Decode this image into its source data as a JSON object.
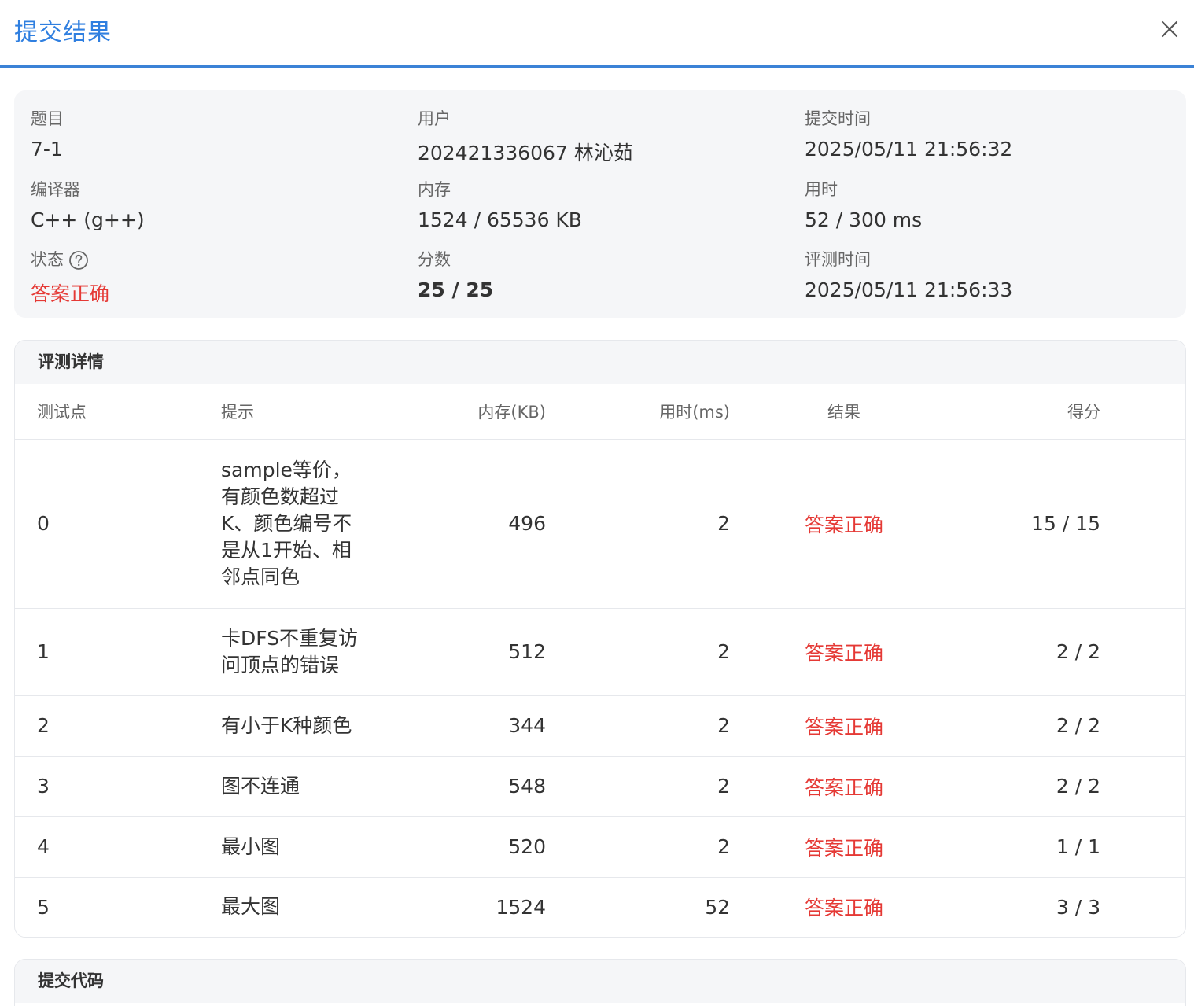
{
  "dialog": {
    "title": "提交结果"
  },
  "info": {
    "problem": {
      "label": "题目",
      "value": "7-1"
    },
    "user": {
      "label": "用户",
      "value": "202421336067 林沁茹"
    },
    "submit_time": {
      "label": "提交时间",
      "value": "2025/05/11 21:56:32"
    },
    "compiler": {
      "label": "编译器",
      "value": "C++ (g++)"
    },
    "memory": {
      "label": "内存",
      "value": "1524 / 65536 KB"
    },
    "time_used": {
      "label": "用时",
      "value": "52 / 300 ms"
    },
    "status": {
      "label": "状态",
      "value": "答案正确"
    },
    "score": {
      "label": "分数",
      "value": "25 / 25"
    },
    "judge_time": {
      "label": "评测时间",
      "value": "2025/05/11 21:56:33"
    }
  },
  "judge_details": {
    "title": "评测详情",
    "columns": [
      "测试点",
      "提示",
      "内存(KB)",
      "用时(ms)",
      "结果",
      "得分"
    ],
    "rows": [
      {
        "case": "0",
        "hint": "sample等价，有颜色数超过K、颜色编号不是从1开始、相邻点同色",
        "memory": "496",
        "time": "2",
        "result": "答案正确",
        "score": "15 / 15"
      },
      {
        "case": "1",
        "hint": "卡DFS不重复访问顶点的错误",
        "memory": "512",
        "time": "2",
        "result": "答案正确",
        "score": "2 / 2"
      },
      {
        "case": "2",
        "hint": "有小于K种颜色",
        "memory": "344",
        "time": "2",
        "result": "答案正确",
        "score": "2 / 2"
      },
      {
        "case": "3",
        "hint": "图不连通",
        "memory": "548",
        "time": "2",
        "result": "答案正确",
        "score": "2 / 2"
      },
      {
        "case": "4",
        "hint": "最小图",
        "memory": "520",
        "time": "2",
        "result": "答案正确",
        "score": "1 / 1"
      },
      {
        "case": "5",
        "hint": "最大图",
        "memory": "1524",
        "time": "52",
        "result": "答案正确",
        "score": "3 / 3"
      }
    ]
  },
  "submitted_code": {
    "title": "提交代码"
  },
  "colors": {
    "accent": "#2f7fe0",
    "success_text": "#e53935",
    "panel_bg": "#f5f6f8"
  }
}
